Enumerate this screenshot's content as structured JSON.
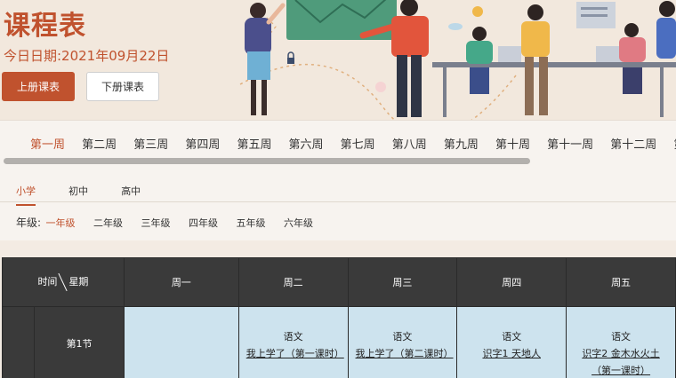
{
  "header": {
    "title": "课程表",
    "date_text": "今日日期:2021年09月22日",
    "buttons": {
      "first": "上册课表",
      "second": "下册课表"
    }
  },
  "weeks": [
    "第一周",
    "第二周",
    "第三周",
    "第四周",
    "第五周",
    "第六周",
    "第七周",
    "第八周",
    "第九周",
    "第十周",
    "第十一周",
    "第十二周",
    "第十"
  ],
  "levels": [
    "小学",
    "初中",
    "高中"
  ],
  "grade": {
    "label": "年级:",
    "options": [
      "一年级",
      "二年级",
      "三年级",
      "四年级",
      "五年级",
      "六年级"
    ]
  },
  "table": {
    "corner_left": "时间",
    "corner_right": "星期",
    "days": [
      "周一",
      "周二",
      "周三",
      "周四",
      "周五"
    ],
    "rows": [
      {
        "period": "第1节",
        "cells": [
          {
            "subject": "",
            "lesson": ""
          },
          {
            "subject": "语文",
            "lesson": "我上学了（第一课时）"
          },
          {
            "subject": "语文",
            "lesson": "我上学了（第二课时）"
          },
          {
            "subject": "语文",
            "lesson": "识字1 天地人"
          },
          {
            "subject": "语文",
            "lesson": "识字2 金木水火土（第一课时）"
          }
        ]
      }
    ]
  },
  "colors": {
    "accent": "#c0522e",
    "header_bg": "#f2e8dd",
    "table_head": "#3a3a3a",
    "cell_bg": "#cde3ee"
  }
}
